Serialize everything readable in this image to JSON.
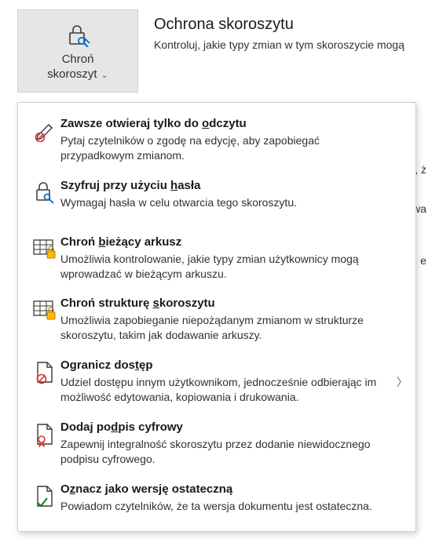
{
  "header": {
    "button_line1": "Chroń",
    "button_line2": "skoroszyt",
    "title": "Ochrona skoroszytu",
    "subtitle": "Kontroluj, jakie typy zmian w tym skoroszycie mogą"
  },
  "side": {
    "t1": ", ż",
    "t2": "wa",
    "t3": "e"
  },
  "menu": {
    "readonly": {
      "title_pre": "Zawsze otwieraj tylko do ",
      "title_u": "o",
      "title_post": "dczytu",
      "desc": "Pytaj czytelników o zgodę na edycję, aby zapobiegać przypadkowym zmianom."
    },
    "encrypt": {
      "title_pre": "Szyfruj przy użyciu ",
      "title_u": "h",
      "title_post": "asła",
      "desc": "Wymagaj hasła w celu otwarcia tego skoroszytu."
    },
    "protect_sheet": {
      "title_pre": "Chroń ",
      "title_u": "b",
      "title_post": "ieżący arkusz",
      "desc": "Umożliwia kontrolowanie, jakie typy zmian użytkownicy mogą wprowadzać w bieżącym arkuszu."
    },
    "protect_structure": {
      "title_pre": "Chroń strukturę ",
      "title_u": "s",
      "title_post": "koroszytu",
      "desc": "Umożliwia zapobieganie niepożądanym zmianom w strukturze skoroszytu, takim jak dodawanie arkuszy."
    },
    "restrict": {
      "title_pre": "Ogranicz dos",
      "title_u": "t",
      "title_post": "ęp",
      "desc": "Udziel dostępu innym użytkownikom, jednocześnie odbierając im możliwość edytowania, kopiowania i drukowania."
    },
    "signature": {
      "title_pre": "Dodaj po",
      "title_u": "d",
      "title_post": "pis cyfrowy",
      "desc": "Zapewnij integralność skoroszytu przez dodanie niewidocznego podpisu cyfrowego."
    },
    "final": {
      "title_pre": "O",
      "title_u": "z",
      "title_post": "nacz jako wersję ostateczną",
      "desc": "Powiadom czytelników, że ta wersja dokumentu jest ostateczna."
    }
  }
}
